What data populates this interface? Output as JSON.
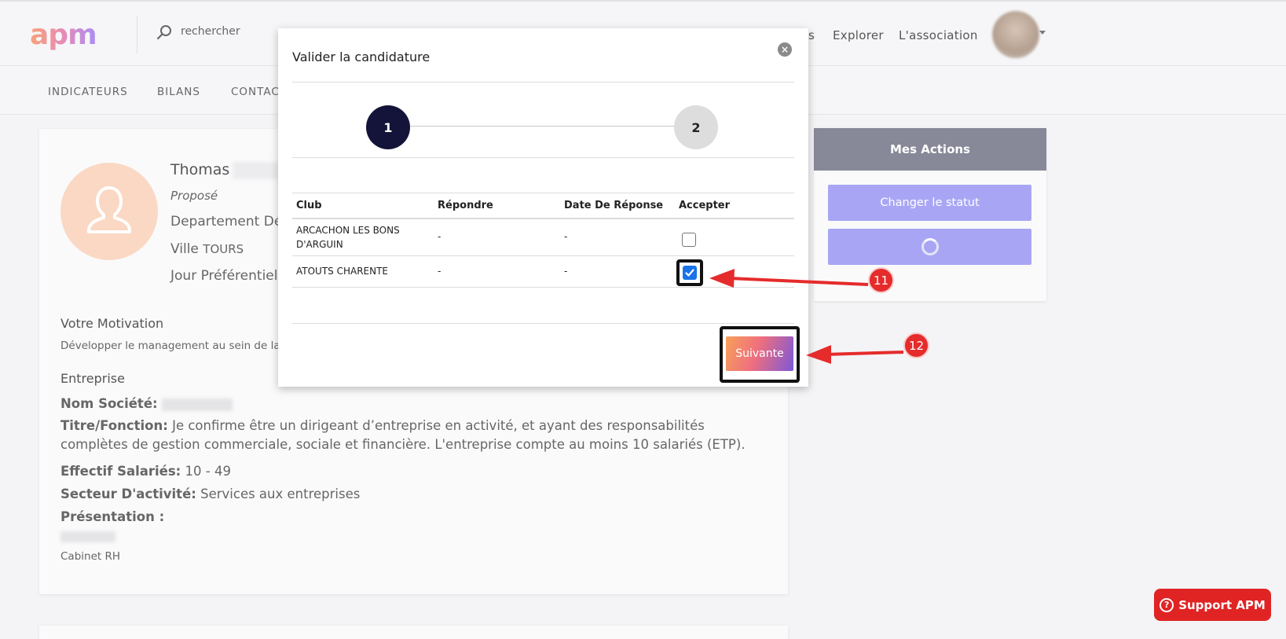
{
  "header": {
    "logo": "apm",
    "search_placeholder": "rechercher",
    "nav": [
      "s",
      "Explorer",
      "L'association"
    ]
  },
  "subnav": {
    "items": [
      "INDICATEURS",
      "BILANS",
      "CONTAC"
    ]
  },
  "profile": {
    "first_name": "Thomas",
    "status": "Proposé",
    "departement": "Departement Dé",
    "ville_label": "Ville",
    "ville_value": "TOURS",
    "jour": "Jour Préférentiel",
    "motivation_title": "Votre Motivation",
    "motivation_text": "Développer le management au sein de la",
    "entreprise_title": "Entreprise",
    "nom_societe_label": "Nom Société:",
    "titre_label": "Titre/Fonction:",
    "titre_value": "Je confirme être un dirigeant d’entreprise en activité, et ayant des responsabilités complètes de gestion commerciale, sociale et financière. L'entreprise compte au moins 10 salariés (ETP).",
    "effectif_label": "Effectif Salariés:",
    "effectif_value": "10 - 49",
    "secteur_label": "Secteur D'activité:",
    "secteur_value": "Services aux entreprises",
    "presentation_label": "Présentation :",
    "footer_text": "Cabinet RH"
  },
  "actions": {
    "title": "Mes Actions",
    "change_status": "Changer le statut"
  },
  "modal": {
    "title": "Valider la candidature",
    "close_icon": "×",
    "steps": [
      "1",
      "2"
    ],
    "columns": [
      "Club",
      "Répondre",
      "Date De Réponse",
      "Accepter"
    ],
    "rows": [
      {
        "club": "ARCACHON LES BONS D'ARGUIN",
        "repondre": "-",
        "date": "-",
        "accepted": false
      },
      {
        "club": "ATOUTS CHARENTE",
        "repondre": "-",
        "date": "-",
        "accepted": true
      }
    ],
    "next_button": "Suivante"
  },
  "annotations": {
    "badge_11": "11",
    "badge_12": "12",
    "color": "#e52b2b"
  },
  "support": {
    "label": "Support APM",
    "icon": "?"
  }
}
